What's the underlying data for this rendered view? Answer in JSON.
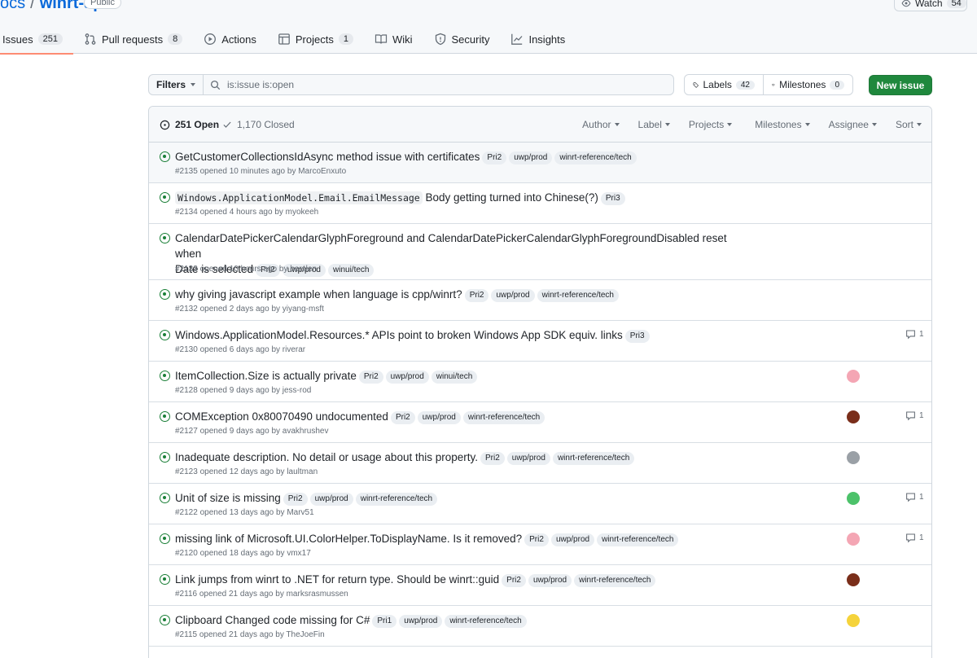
{
  "repo": {
    "owner": "ocs",
    "separator": "/",
    "name": "winrt-api",
    "visibility": "Public"
  },
  "watch": {
    "label": "Watch",
    "count": "54"
  },
  "nav": [
    {
      "label": "Issues",
      "count": "251",
      "icon": "issue-open-icon"
    },
    {
      "label": "Pull requests",
      "count": "8",
      "icon": "git-pull-request-icon"
    },
    {
      "label": "Actions",
      "icon": "play-icon"
    },
    {
      "label": "Projects",
      "count": "1",
      "icon": "table-icon"
    },
    {
      "label": "Wiki",
      "icon": "book-icon"
    },
    {
      "label": "Security",
      "icon": "shield-icon"
    },
    {
      "label": "Insights",
      "icon": "graph-icon"
    }
  ],
  "filters": {
    "label": "Filters",
    "query": "is:issue is:open"
  },
  "labels_btn": {
    "label": "Labels",
    "count": "42"
  },
  "milestones_btn": {
    "label": "Milestones",
    "count": "0"
  },
  "new_issue": "New issue",
  "states": {
    "open": "251 Open",
    "closed": "1,170 Closed"
  },
  "menus": [
    "Author",
    "Label",
    "Projects",
    "Milestones",
    "Assignee",
    "Sort"
  ],
  "issues": [
    {
      "code": "",
      "title": "GetCustomerCollectionsIdAsync method issue with certificates",
      "title2": "",
      "labels": [
        "Pri2",
        "uwp/prod",
        "winrt-reference/tech"
      ],
      "meta": "#2135 opened 10 minutes ago by MarcoEnxuto",
      "avatar": "",
      "comments": ""
    },
    {
      "code": "Windows.ApplicationModel.Email.EmailMessage",
      "title": "Body getting turned into Chinese(?)",
      "title2": "",
      "labels": [
        "Pri3"
      ],
      "meta": "#2134 opened 4 hours ago by myokeeh",
      "avatar": "",
      "comments": ""
    },
    {
      "code": "",
      "title": "CalendarDatePickerCalendarGlyphForeground and CalendarDatePickerCalendarGlyphForegroundDisabled reset when",
      "title2": "Date is selected",
      "labels": [
        "Pri2",
        "uwp/prod",
        "winui/tech"
      ],
      "meta": "#2133 opened 10 hours ago by berslen",
      "avatar": "",
      "comments": ""
    },
    {
      "code": "",
      "title": "why giving javascript example when language is cpp/winrt?",
      "title2": "",
      "labels": [
        "Pri2",
        "uwp/prod",
        "winrt-reference/tech"
      ],
      "meta": "#2132 opened 2 days ago by yiyang-msft",
      "avatar": "",
      "comments": ""
    },
    {
      "code": "",
      "title": "Windows.ApplicationModel.Resources.* APIs point to broken Windows App SDK equiv. links",
      "title2": "",
      "labels": [
        "Pri3"
      ],
      "meta": "#2130 opened 6 days ago by riverar",
      "avatar": "",
      "comments": "1"
    },
    {
      "code": "",
      "title": "ItemCollection.Size is actually private",
      "title2": "",
      "labels": [
        "Pri2",
        "uwp/prod",
        "winui/tech"
      ],
      "meta": "#2128 opened 9 days ago by jess-rod",
      "avatar": "#f4a6b4",
      "comments": ""
    },
    {
      "code": "",
      "title": "COMException 0x80070490 undocumented",
      "title2": "",
      "labels": [
        "Pri2",
        "uwp/prod",
        "winrt-reference/tech"
      ],
      "meta": "#2127 opened 9 days ago by avakhrushev",
      "avatar": "#7a2e1a",
      "comments": "1"
    },
    {
      "code": "",
      "title": "Inadequate description. No detail or usage about this property.",
      "title2": "",
      "labels": [
        "Pri2",
        "uwp/prod",
        "winrt-reference/tech"
      ],
      "meta": "#2123 opened 12 days ago by laultman",
      "avatar": "#9aa0a6",
      "comments": ""
    },
    {
      "code": "",
      "title": "Unit of size is missing",
      "title2": "",
      "labels": [
        "Pri2",
        "uwp/prod",
        "winrt-reference/tech"
      ],
      "meta": "#2122 opened 13 days ago by Marv51",
      "avatar": "#4cc26a",
      "comments": "1"
    },
    {
      "code": "",
      "title": "missing link of Microsoft.UI.ColorHelper.ToDisplayName. Is it removed?",
      "title2": "",
      "labels": [
        "Pri2",
        "uwp/prod",
        "winrt-reference/tech"
      ],
      "meta": "#2120 opened 18 days ago by vmx17",
      "avatar": "#f4a6b4",
      "comments": "1"
    },
    {
      "code": "",
      "title": "Link jumps from winrt to .NET for return type. Should be winrt::guid",
      "title2": "",
      "labels": [
        "Pri2",
        "uwp/prod",
        "winrt-reference/tech"
      ],
      "meta": "#2116 opened 21 days ago by marksrasmussen",
      "avatar": "#7a2e1a",
      "comments": ""
    },
    {
      "code": "",
      "title": "Clipboard Changed code missing for C#",
      "title2": "",
      "labels": [
        "Pri1",
        "uwp/prod",
        "winrt-reference/tech"
      ],
      "meta": "#2115 opened 21 days ago by TheJoeFin",
      "avatar": "#f5d33b",
      "comments": ""
    }
  ]
}
